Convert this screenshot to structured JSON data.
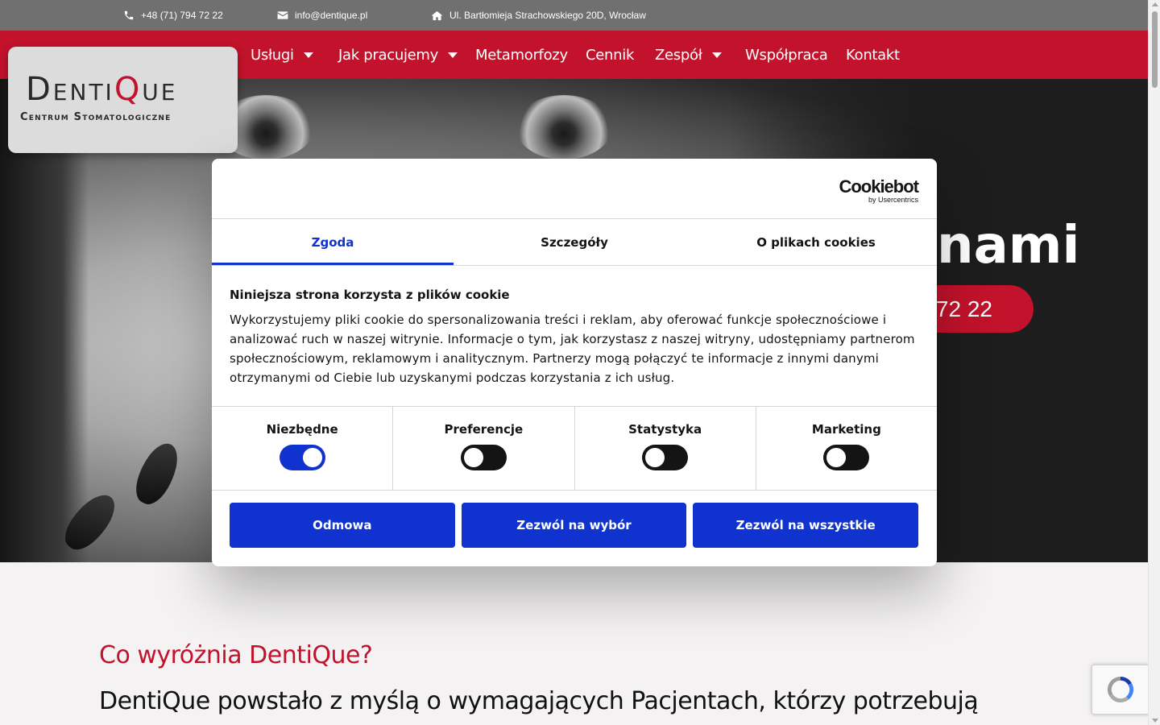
{
  "topbar": {
    "phone": "+48 (71) 794 72 22",
    "email": "info@dentique.pl",
    "address": "Ul. Bartłomieja Strachowskiego 20D, Wrocław"
  },
  "logo": {
    "name_prefix": "Denti",
    "name_q": "Q",
    "name_suffix": "ue",
    "tagline": "Centrum Stomatologiczne"
  },
  "nav": {
    "items": [
      {
        "label": "Usługi",
        "has_dropdown": true
      },
      {
        "label": "Jak pracujemy",
        "has_dropdown": true
      },
      {
        "label": "Metamorfozy",
        "has_dropdown": false
      },
      {
        "label": "Cennik",
        "has_dropdown": false
      },
      {
        "label": "Zespół",
        "has_dropdown": true
      },
      {
        "label": "Współpraca",
        "has_dropdown": false
      },
      {
        "label": "Kontakt",
        "has_dropdown": false
      }
    ]
  },
  "hero": {
    "heading_fragment": "nami",
    "cta_fragment": "72 22"
  },
  "section": {
    "title": "Co wyróżnia DentiQue?",
    "text": "DentiQue powstało z myślą o wymagających Pacjentach, którzy potrzebują"
  },
  "cookie_dialog": {
    "brand": "Cookiebot",
    "brand_sub": "by Usercentrics",
    "tabs": [
      "Zgoda",
      "Szczegóły",
      "O plikach cookies"
    ],
    "active_tab": "Zgoda",
    "title": "Niniejsza strona korzysta z plików cookie",
    "description": "Wykorzystujemy pliki cookie do spersonalizowania treści i reklam, aby oferować funkcje społecznościowe i analizować ruch w naszej witrynie. Informacje o tym, jak korzystasz z naszej witryny, udostępniamy partnerom społecznościowym, reklamowym i analitycznym. Partnerzy mogą połączyć te informacje z innymi danymi otrzymanymi od Ciebie lub uzyskanymi podczas korzystania z ich usług.",
    "categories": [
      {
        "label": "Niezbędne",
        "enabled": true
      },
      {
        "label": "Preferencje",
        "enabled": false
      },
      {
        "label": "Statystyka",
        "enabled": false
      },
      {
        "label": "Marketing",
        "enabled": false
      }
    ],
    "buttons": {
      "deny": "Odmowa",
      "allow_selection": "Zezwól na wybór",
      "allow_all": "Zezwól na wszystkie"
    }
  },
  "colors": {
    "brand_red": "#c3122b",
    "topbar_gray": "#707070",
    "cookie_blue": "#1032cf"
  }
}
